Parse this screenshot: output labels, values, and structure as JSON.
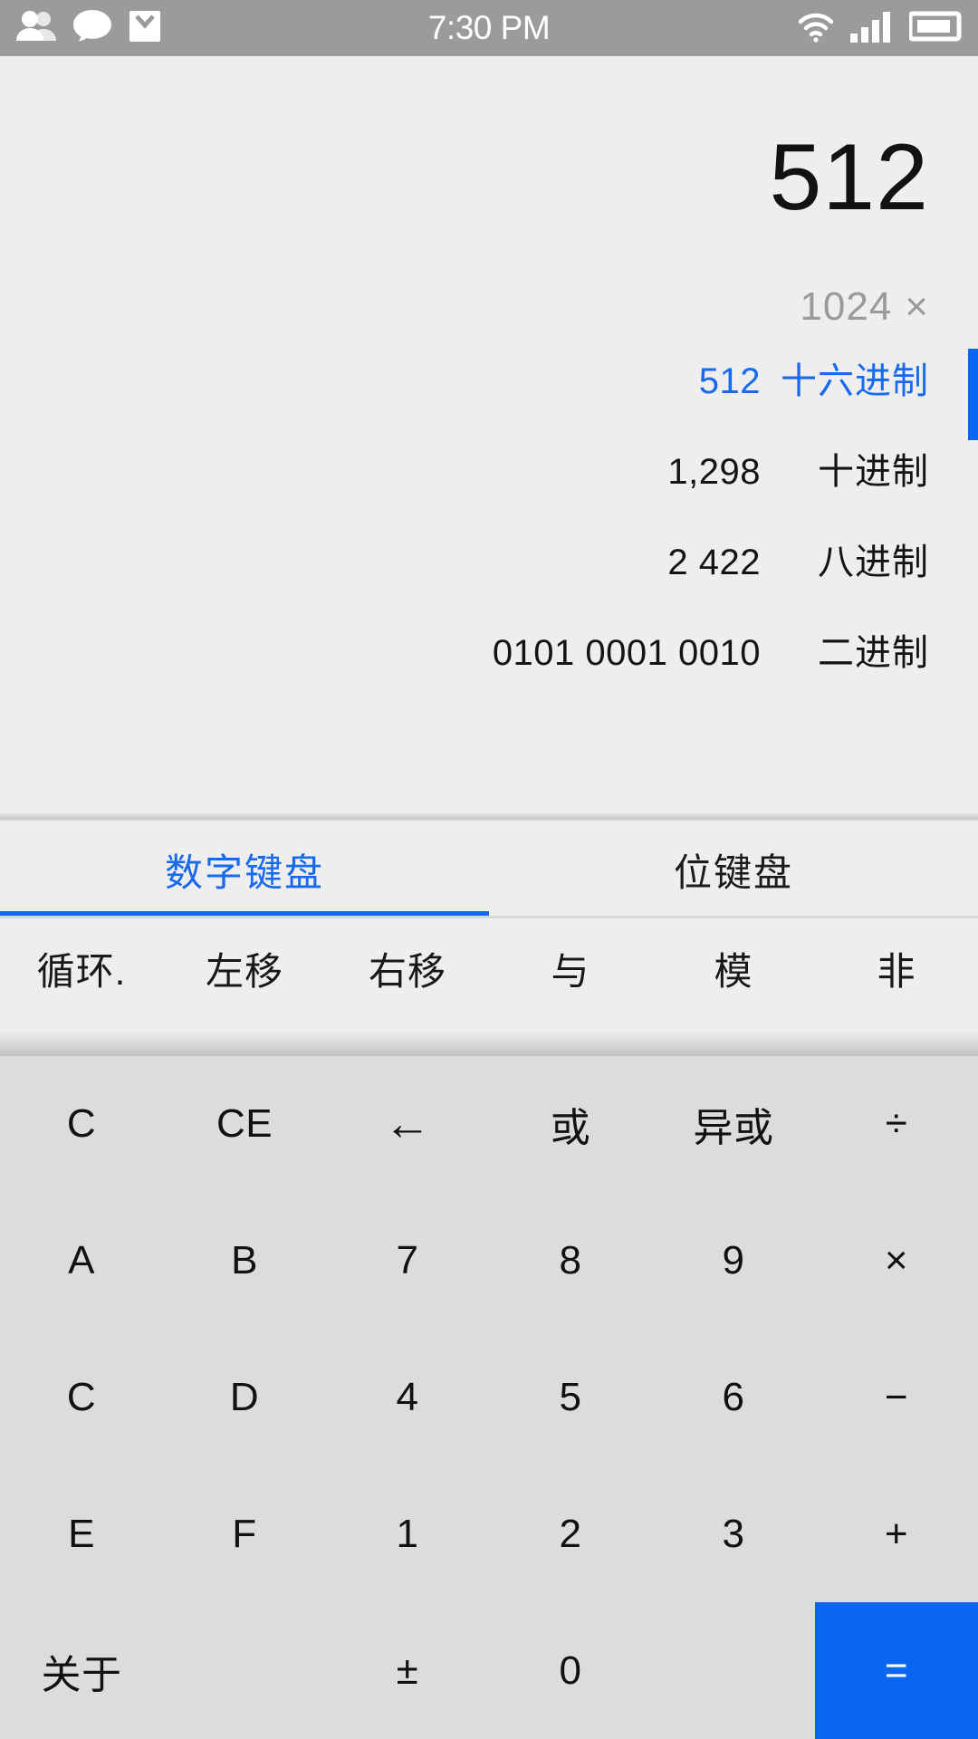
{
  "statusbar": {
    "time": "7:30 PM",
    "icons_left": [
      "people-icon",
      "chat-bubble-icon",
      "mail-icon"
    ],
    "icons_right": [
      "wifi-icon",
      "cellular-signal-icon",
      "battery-icon"
    ],
    "background_color": "#9b9b9b"
  },
  "display": {
    "main_value": "512",
    "pending_value": "1024",
    "pending_operator": "×",
    "bases": [
      {
        "value": "512",
        "label": "十六进制",
        "active": true
      },
      {
        "value": "1,298",
        "label": "十进制",
        "active": false
      },
      {
        "value": "2 422",
        "label": "八进制",
        "active": false
      },
      {
        "value": "0101 0001 0010",
        "label": "二进制",
        "active": false
      }
    ],
    "accent_color": "#1769f0"
  },
  "tabs": [
    {
      "label": "数字键盘",
      "active": true
    },
    {
      "label": "位键盘",
      "active": false
    }
  ],
  "function_row": [
    "循环.",
    "左移",
    "右移",
    "与",
    "模",
    "非"
  ],
  "keypad": {
    "rows": [
      [
        "C",
        "CE",
        "←",
        "或",
        "异或",
        "÷"
      ],
      [
        "A",
        "B",
        "7",
        "8",
        "9",
        "×"
      ],
      [
        "C",
        "D",
        "4",
        "5",
        "6",
        "−"
      ],
      [
        "E",
        "F",
        "1",
        "2",
        "3",
        "+"
      ],
      [
        "关于",
        "",
        "±",
        "0",
        "",
        "="
      ]
    ],
    "equals_color": "#0a66f0",
    "background_color": "#dcdcdc"
  }
}
